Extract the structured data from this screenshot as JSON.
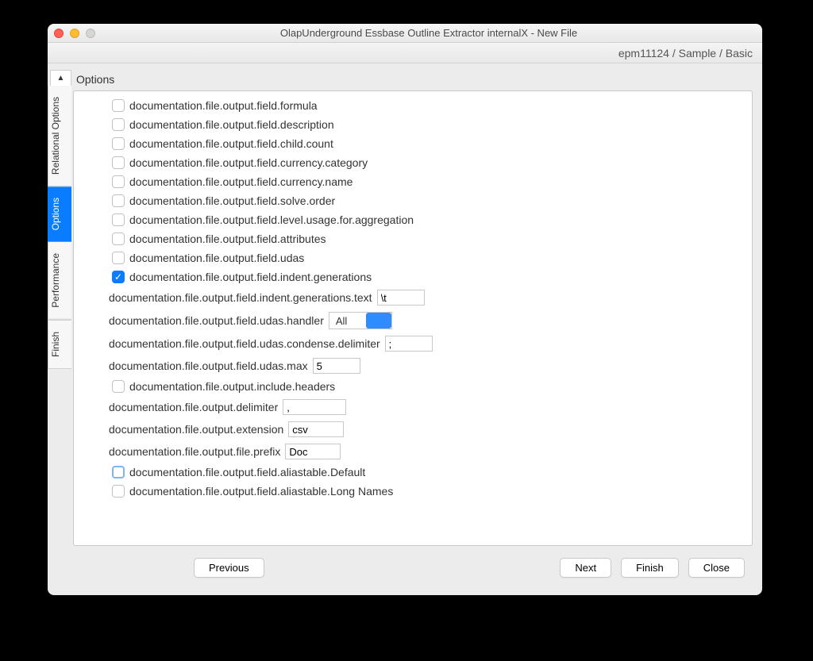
{
  "window": {
    "title": "OlapUnderground Essbase Outline Extractor internalX - New File"
  },
  "breadcrumb": "epm11124 / Sample / Basic",
  "tabs": {
    "scroll_hint": "▲",
    "relational": "Relational Options",
    "options": "Options",
    "performance": "Performance",
    "finish": "Finish"
  },
  "group": {
    "title": "Options"
  },
  "items": {
    "formula": "documentation.file.output.field.formula",
    "description": "documentation.file.output.field.description",
    "childcount": "documentation.file.output.field.child.count",
    "currcat": "documentation.file.output.field.currency.category",
    "currname": "documentation.file.output.field.currency.name",
    "solveorder": "documentation.file.output.field.solve.order",
    "levelusage": "documentation.file.output.field.level.usage.for.aggregation",
    "attributes": "documentation.file.output.field.attributes",
    "udas": "documentation.file.output.field.udas",
    "indentgen": "documentation.file.output.field.indent.generations",
    "indentgen_text_label": "documentation.file.output.field.indent.generations.text",
    "indentgen_text_value": "\\t",
    "udashandler_label": "documentation.file.output.field.udas.handler",
    "udashandler_value": "All",
    "udascondense_label": "documentation.file.output.field.udas.condense.delimiter",
    "udascondense_value": ";",
    "udasmax_label": "documentation.file.output.field.udas.max",
    "udasmax_value": "5",
    "includeheaders": "documentation.file.output.include.headers",
    "delimiter_label": "documentation.file.output.delimiter",
    "delimiter_value": ",",
    "extension_label": "documentation.file.output.extension",
    "extension_value": "csv",
    "fileprefix_label": "documentation.file.output.file.prefix",
    "fileprefix_value": "Doc",
    "alias_default": "documentation.file.output.field.aliastable.Default",
    "alias_longnames": "documentation.file.output.field.aliastable.Long Names"
  },
  "buttons": {
    "previous": "Previous",
    "next": "Next",
    "finish": "Finish",
    "close": "Close"
  }
}
